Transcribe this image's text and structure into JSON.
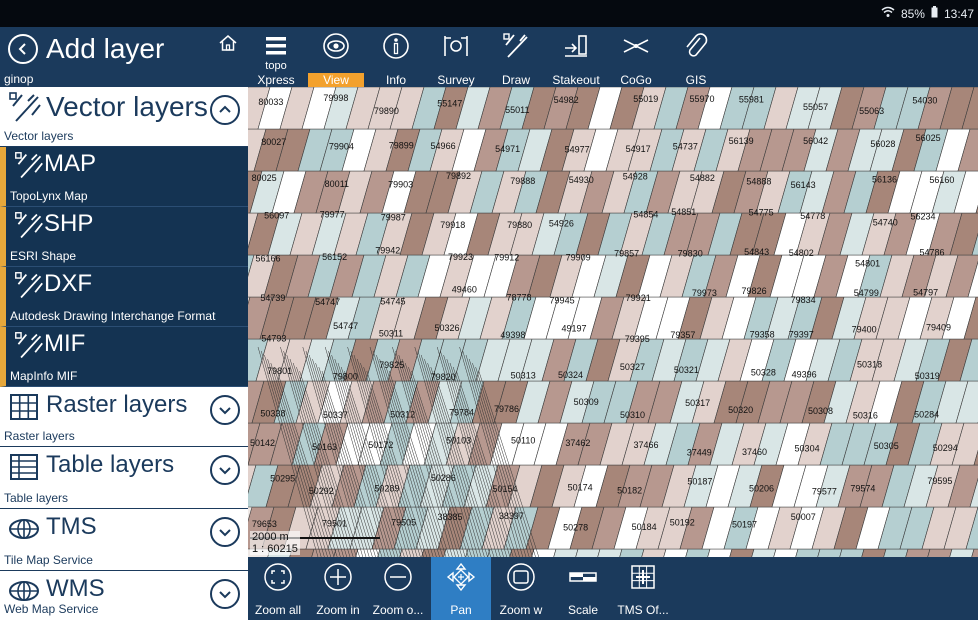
{
  "status": {
    "wifi": "wifi-icon",
    "battery_pct": "85%",
    "time": "13:47"
  },
  "panel": {
    "title": "Add layer",
    "subtitle": "ginop",
    "sections": [
      {
        "name": "Vector layers",
        "desc": "Vector layers",
        "icon": "vector-layers-icon"
      },
      {
        "name": "MAP",
        "desc": "TopoLynx Map",
        "icon": "map-file-icon"
      },
      {
        "name": "SHP",
        "desc": "ESRI Shape",
        "icon": "shp-file-icon"
      },
      {
        "name": "DXF",
        "desc": "Autodesk Drawing Interchange Format",
        "icon": "dxf-file-icon"
      },
      {
        "name": "MIF",
        "desc": "MapInfo MIF",
        "icon": "mif-file-icon"
      },
      {
        "name": "Raster layers",
        "desc": "Raster layers",
        "icon": "raster-grid-icon"
      },
      {
        "name": "Table layers",
        "desc": "Table layers",
        "icon": "table-icon"
      },
      {
        "name": "TMS",
        "desc": "Tile Map Service",
        "icon": "globe-icon"
      },
      {
        "name": "WMS",
        "desc": "Web Map Service",
        "icon": "globe-icon"
      }
    ]
  },
  "toolbar": {
    "items": [
      {
        "label_top": "topo",
        "label": "Xpress",
        "icon": "menu-icon"
      },
      {
        "label": "View",
        "icon": "eye-icon",
        "active": true
      },
      {
        "label": "Info",
        "icon": "info-icon"
      },
      {
        "label": "Survey",
        "icon": "survey-icon"
      },
      {
        "label": "Draw",
        "icon": "draw-icon"
      },
      {
        "label": "Stakeout",
        "icon": "stakeout-icon"
      },
      {
        "label": "CoGo",
        "icon": "cogo-icon"
      },
      {
        "label": "GIS",
        "icon": "paperclip-icon"
      }
    ]
  },
  "map": {
    "scale_distance": "2000 m",
    "scale_ratio": "1 : 60215",
    "labels": [
      "80033",
      "79998",
      "79890",
      "55147",
      "55011",
      "54982",
      "55019",
      "55970",
      "55981",
      "55057",
      "55063",
      "54030",
      "80027",
      "79904",
      "79899",
      "54966",
      "54971",
      "54977",
      "54917",
      "54737",
      "56139",
      "56042",
      "56028",
      "56025",
      "80025",
      "80011",
      "79903",
      "79892",
      "79888",
      "54930",
      "54928",
      "54882",
      "54888",
      "56143",
      "56136",
      "56160",
      "56097",
      "79977",
      "79987",
      "79918",
      "79880",
      "54926",
      "54854",
      "54851",
      "54775",
      "54778",
      "54740",
      "56234",
      "56166",
      "56152",
      "79942",
      "79923",
      "79912",
      "79909",
      "79857",
      "79830",
      "54843",
      "54802",
      "54801",
      "54786",
      "54739",
      "54747",
      "54745",
      "49460",
      "78778",
      "79945",
      "79921",
      "79973",
      "79826",
      "79834",
      "54799",
      "54797",
      "54793",
      "54747",
      "50311",
      "50326",
      "49398",
      "49197",
      "79395",
      "79357",
      "79358",
      "79397",
      "79400",
      "79409",
      "79801",
      "79800",
      "79825",
      "79820",
      "50313",
      "50324",
      "50327",
      "50321",
      "50328",
      "49396",
      "50318",
      "50319",
      "50338",
      "50337",
      "50312",
      "79784",
      "79786",
      "50309",
      "50310",
      "50317",
      "50320",
      "50308",
      "50316",
      "50284",
      "50142",
      "50163",
      "50172",
      "50103",
      "50110",
      "37462",
      "37466",
      "37449",
      "37460",
      "50304",
      "50305",
      "50294",
      "50295",
      "50292",
      "50289",
      "50286",
      "50154",
      "50174",
      "50182",
      "50187",
      "50206",
      "79577",
      "79574",
      "79595",
      "79653",
      "79501",
      "79505",
      "38385",
      "38397",
      "50278",
      "50184",
      "50192",
      "50197",
      "50007"
    ]
  },
  "bottombar": {
    "items": [
      {
        "label": "Zoom all",
        "icon": "zoom-all-icon"
      },
      {
        "label": "Zoom in",
        "icon": "zoom-in-icon"
      },
      {
        "label": "Zoom o...",
        "icon": "zoom-out-icon"
      },
      {
        "label": "Pan",
        "icon": "pan-icon",
        "active": true
      },
      {
        "label": "Zoom w",
        "icon": "zoom-window-icon"
      },
      {
        "label": "Scale",
        "icon": "scale-icon"
      },
      {
        "label": "TMS Of...",
        "icon": "tms-offset-icon"
      }
    ]
  },
  "colors": {
    "panel_bg": "#1b3a5c",
    "active_tab": "#f3a12d",
    "pan_active": "#2f7ec4",
    "selected_border": "#e7a83b",
    "parcel_teal": "#b5cfd1",
    "parcel_brown": "#b7988f",
    "parcel_pink": "#e2d2cd"
  }
}
